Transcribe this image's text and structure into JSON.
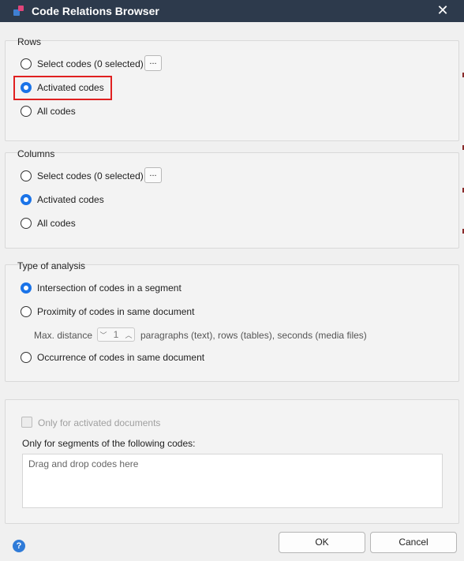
{
  "window": {
    "title": "Code Relations Browser",
    "close_icon": "close-icon"
  },
  "rows": {
    "label": "Rows",
    "options": [
      {
        "label": "Select codes (0 selected)",
        "checked": false
      },
      {
        "label": "Activated codes",
        "checked": true
      },
      {
        "label": "All codes",
        "checked": false
      }
    ],
    "dots_label": "..."
  },
  "columns": {
    "label": "Columns",
    "options": [
      {
        "label": "Select codes (0 selected)",
        "checked": false
      },
      {
        "label": "Activated codes",
        "checked": true
      },
      {
        "label": "All codes",
        "checked": false
      }
    ],
    "dots_label": "..."
  },
  "analysis": {
    "label": "Type of analysis",
    "options": [
      {
        "label": "Intersection of codes in a segment",
        "checked": true
      },
      {
        "label": "Proximity of codes in same document",
        "checked": false
      },
      {
        "label": "Occurrence of codes in same document",
        "checked": false
      }
    ],
    "max_distance_label": "Max. distance",
    "max_distance_value": "1",
    "distance_units": "paragraphs (text), rows (tables), seconds (media files)"
  },
  "filters": {
    "activated_docs_label": "Only for activated documents",
    "activated_docs_checked": false,
    "segments_label": "Only for segments of the following codes:",
    "dropzone_placeholder": "Drag and drop codes here"
  },
  "buttons": {
    "ok": "OK",
    "cancel": "Cancel"
  },
  "help_icon_glyph": "?",
  "colors": {
    "titlebar": "#2d3a4c",
    "accent": "#1a73e8",
    "highlight": "#e02020"
  }
}
